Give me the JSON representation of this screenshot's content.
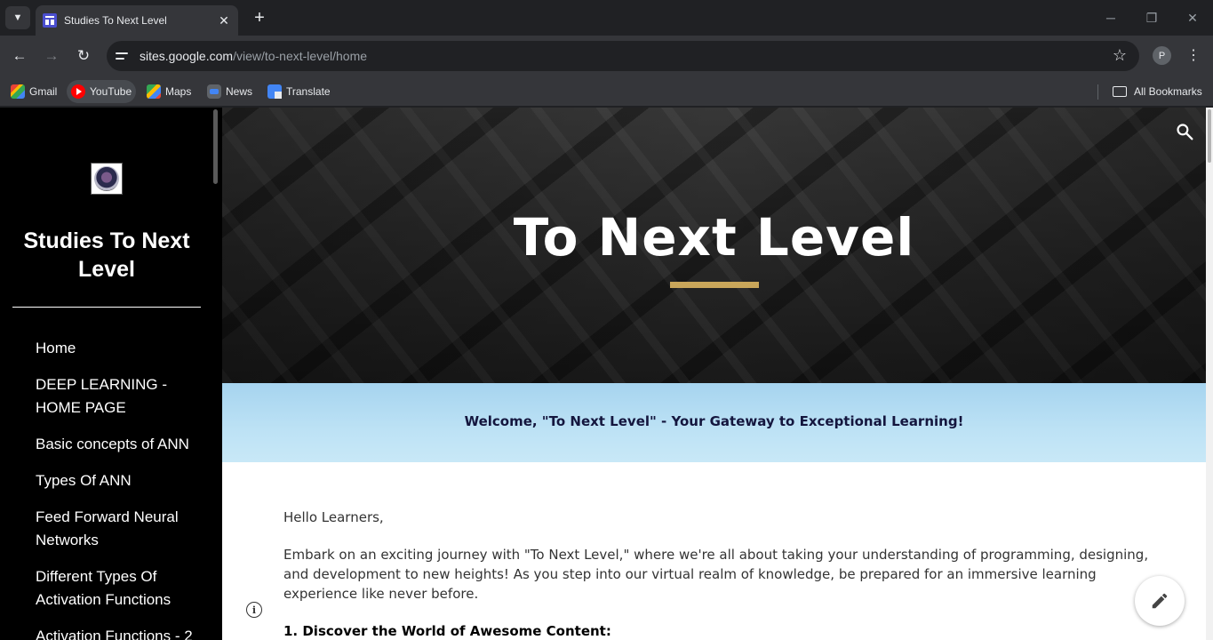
{
  "browser": {
    "tab_title": "Studies To Next Level",
    "url_host": "sites.google.com",
    "url_path": "/view/to-next-level/home",
    "profile_initial": "P",
    "bookmarks": [
      "Gmail",
      "YouTube",
      "Maps",
      "News",
      "Translate"
    ],
    "all_bookmarks": "All Bookmarks"
  },
  "sidebar": {
    "site_name": "Studies To Next Level",
    "nav": [
      "Home",
      "DEEP LEARNING - HOME PAGE",
      "Basic concepts of ANN",
      "Types Of ANN",
      "Feed Forward Neural Networks",
      "Different Types Of Activation Functions",
      "Activation Functions - 2"
    ]
  },
  "hero": {
    "title": "To Next Level",
    "accent_color": "#c9a65a"
  },
  "welcome": {
    "text": "Welcome, \"To Next Level\" - Your Gateway to Exceptional Learning!"
  },
  "content": {
    "greeting": "Hello Learners,",
    "intro": "Embark on an exciting journey with \"To Next Level,\" where we're all about taking your understanding of programming, designing, and development to new heights! As you step into our virtual realm of knowledge, be prepared for an immersive learning experience like never before.",
    "section_1": "1. Discover the World of Awesome Content:"
  }
}
